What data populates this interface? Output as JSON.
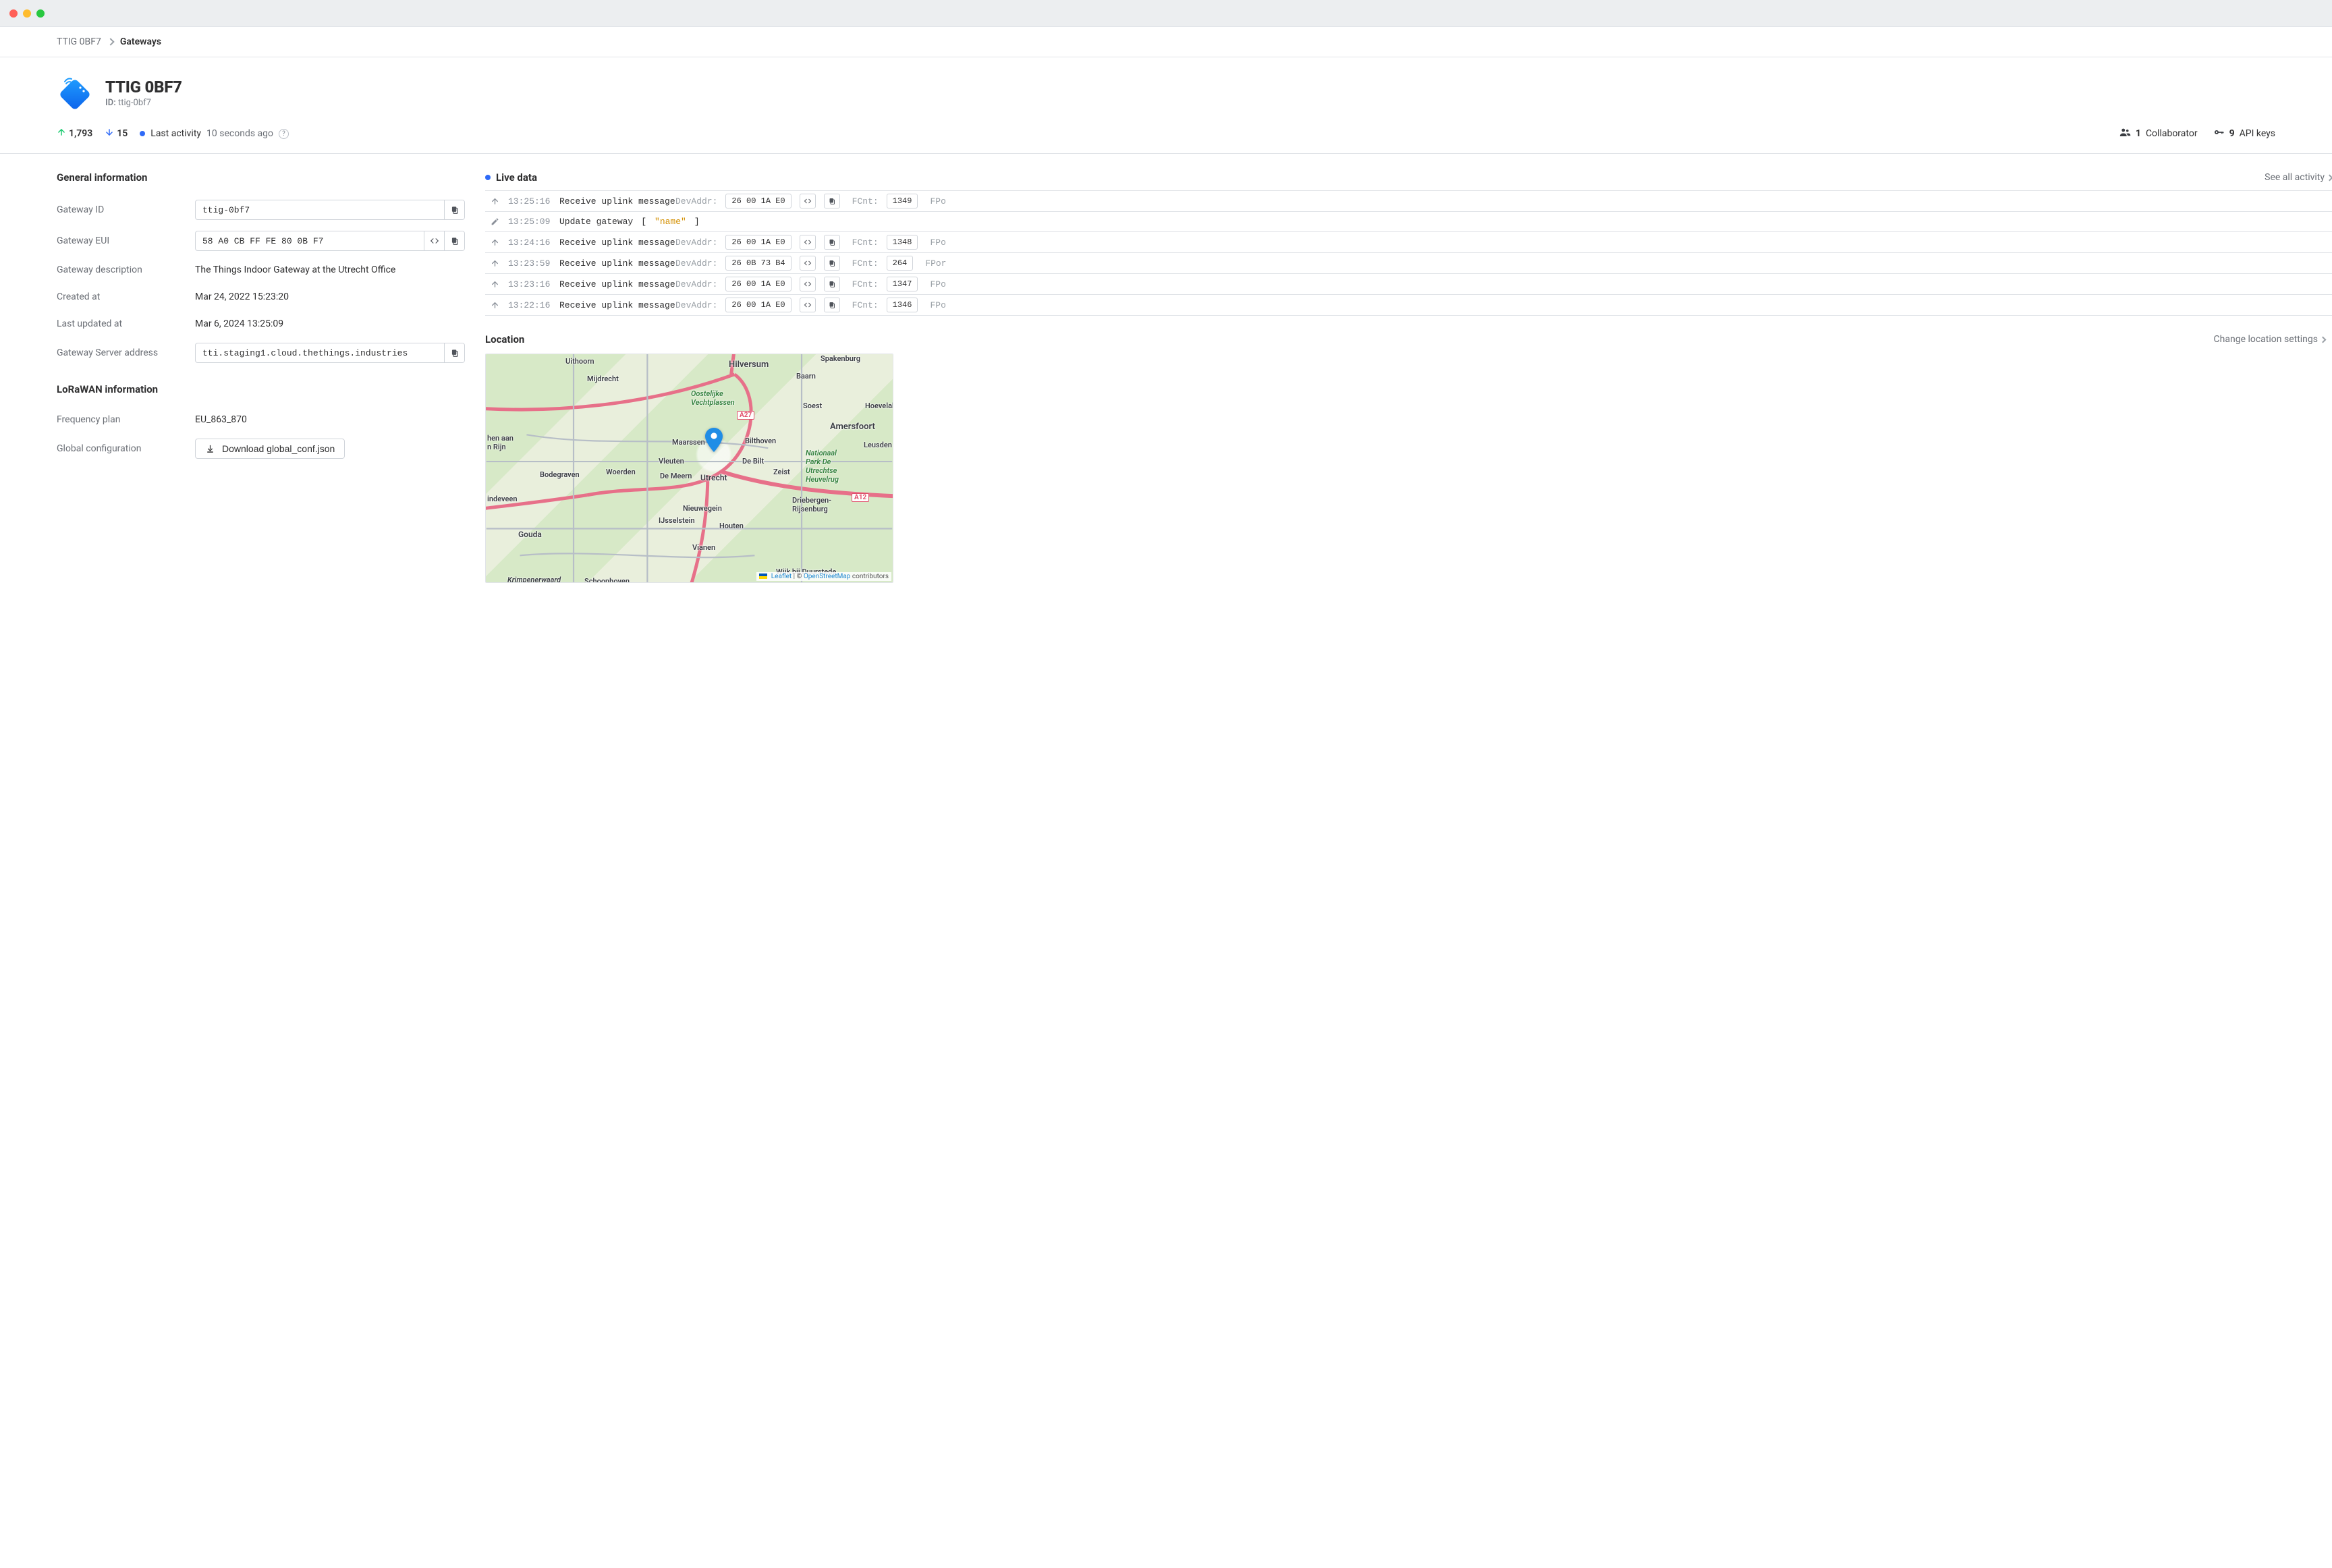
{
  "breadcrumb": {
    "root": "TTIG 0BF7",
    "leaf": "Gateways"
  },
  "header": {
    "title": "TTIG 0BF7",
    "id_label": "ID:",
    "id_value": "ttig-0bf7"
  },
  "stats": {
    "uplinks": "1,793",
    "downlinks": "15",
    "activity_label": "Last activity",
    "activity_value": "10 seconds ago",
    "collaborators_count": "1",
    "collaborators_label": "Collaborator",
    "api_keys_count": "9",
    "api_keys_label": "API keys"
  },
  "general": {
    "title": "General information",
    "rows": {
      "gateway_id": {
        "label": "Gateway ID",
        "value": "ttig-0bf7"
      },
      "gateway_eui": {
        "label": "Gateway EUI",
        "value": "58 A0 CB FF FE 80 0B F7"
      },
      "description": {
        "label": "Gateway description",
        "value": "The Things Indoor Gateway at the Utrecht Office"
      },
      "created_at": {
        "label": "Created at",
        "value": "Mar 24, 2022 15:23:20"
      },
      "updated_at": {
        "label": "Last updated at",
        "value": "Mar 6, 2024 13:25:09"
      },
      "server_addr": {
        "label": "Gateway Server address",
        "value": "tti.staging1.cloud.thethings.industries"
      }
    }
  },
  "lorawan": {
    "title": "LoRaWAN information",
    "freq_plan_label": "Frequency plan",
    "freq_plan_value": "EU_863_870",
    "global_conf_label": "Global configuration",
    "download_label": "Download global_conf.json"
  },
  "live": {
    "title": "Live data",
    "see_all": "See all activity",
    "devaddr_label": "DevAddr:",
    "fcnt_label": "FCnt:",
    "fport_label": "FPo",
    "fport_label_long": "FPor",
    "rows": [
      {
        "type": "uplink",
        "ts": "13:25:16",
        "msg": "Receive uplink message",
        "devaddr": "26 00 1A E0",
        "fcnt": "1349"
      },
      {
        "type": "update",
        "ts": "13:25:09",
        "msg": "Update gateway",
        "payload": "\"name\""
      },
      {
        "type": "uplink",
        "ts": "13:24:16",
        "msg": "Receive uplink message",
        "devaddr": "26 00 1A E0",
        "fcnt": "1348"
      },
      {
        "type": "uplink",
        "ts": "13:23:59",
        "msg": "Receive uplink message",
        "devaddr": "26 0B 73 B4",
        "fcnt": "264"
      },
      {
        "type": "uplink",
        "ts": "13:23:16",
        "msg": "Receive uplink message",
        "devaddr": "26 00 1A E0",
        "fcnt": "1347"
      },
      {
        "type": "uplink",
        "ts": "13:22:16",
        "msg": "Receive uplink message",
        "devaddr": "26 00 1A E0",
        "fcnt": "1346"
      }
    ]
  },
  "location": {
    "title": "Location",
    "change_link": "Change location settings",
    "attribution_leaflet": "Leaflet",
    "attribution_sep": " | © ",
    "attribution_osm": "OpenStreetMap",
    "attribution_suffix": " contributors",
    "roads": {
      "a27": "A27",
      "a12": "A12"
    },
    "cities": {
      "hilversum": "Hilversum",
      "baarn": "Baarn",
      "soest": "Soest",
      "amersfoort": "Amersfoort",
      "bilthoven": "Bilthoven",
      "debilt": "De Bilt",
      "zeist": "Zeist",
      "utrecht": "Utrecht",
      "nieuwegein": "Nieuwegein",
      "houten": "Houten",
      "vianen": "Vianen",
      "driebergen": "Driebergen-\nRijsenburg",
      "leusden": "Leusden",
      "hoevelaken": "Hoevelake",
      "maarssen": "Maarssen",
      "vleuten": "Vleuten",
      "demeern": "De Meern",
      "woerden": "Woerden",
      "bodegraven": "Bodegraven",
      "gouda": "Gouda",
      "schoonhoven": "Schoonhoven",
      "krimpenerwaard": "Krimpenerwaard",
      "ijsselstein": "IJsselstein",
      "mijdrecht": "Mijdrecht",
      "uithoorn": "Uithoorn",
      "wijk": "Wijk bij Duurstede",
      "alphen": "hen aan\nn Rijn",
      "vindeveen": "indeveen",
      "vecht": "Oostelijke\nVechtplassen",
      "heuvelrug": "Nationaal\nPark De\nUtrechtse\nHeuvelrug",
      "spakenburg": "Spakenburg"
    }
  }
}
